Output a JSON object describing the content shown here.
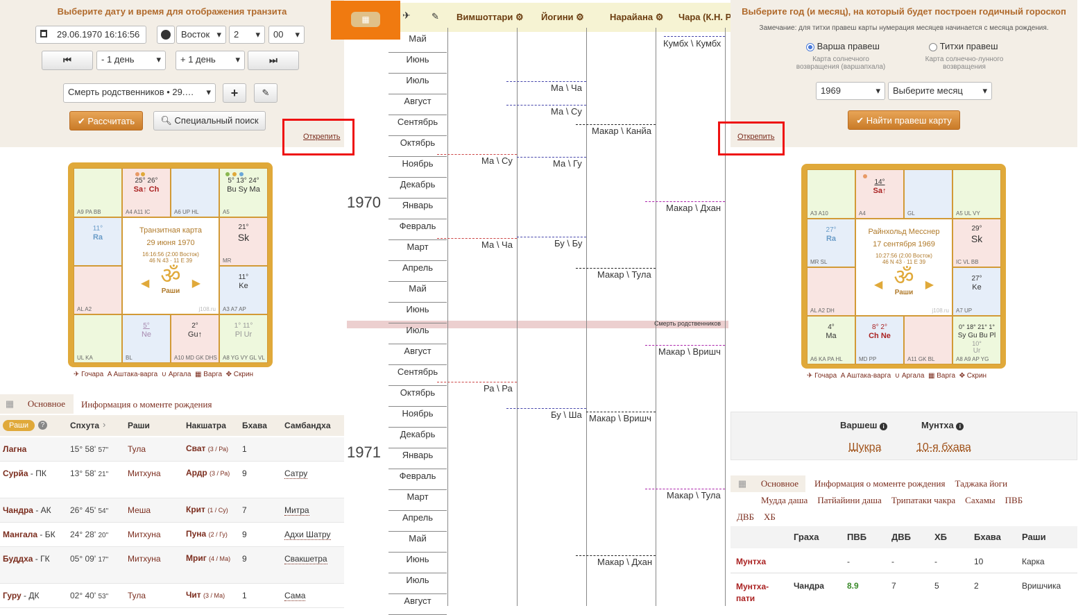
{
  "left": {
    "title": "Выберите дату и время для отображения транзита",
    "datetime": "29.06.1970 16:16:56",
    "direction": "Восток",
    "tz_hours": "2",
    "tz_minutes": "00",
    "minus_day": "- 1 день",
    "plus_day": "+ 1 день",
    "event": "Смерть родственников • 29.…",
    "calc": "Рассчитать",
    "special": "Специальный поиск",
    "unpin": "Открепить"
  },
  "right": {
    "title": "Выберите год (и месяц), на который будет построен годичный гороскоп",
    "note": "Замечание: для титхи правеш карты нумерация месяцев начинается с месяца рождения.",
    "opt1": "Варша правеш",
    "opt1_sub": "Карта солнечного возвращения (варшапхала)",
    "opt2": "Титхи правеш",
    "opt2_sub": "Карта солнечно-лунного возвращения",
    "year": "1969",
    "month": "Выберите месяц",
    "find": "Найти правеш карту",
    "unpin": "Открепить"
  },
  "chart1": {
    "center_title": "Транзитная карта",
    "center_date": "29 июня 1970",
    "center_time": "16:16:56 (2:00 Восток)",
    "center_coords": "46 N 43 · 11 E 39",
    "rashi": "Раши",
    "site": "j108.ru",
    "c1_deg": "25°  26°",
    "c1_pl": "Sa↑ Ch",
    "c1_lbl": "A4 A11 IC",
    "c0_lbl": "A9 PA BB",
    "c2_lbl": "A6 UP HL",
    "c3_deg": "5°  13° 24°",
    "c3_pl": "Bu Sy Ma",
    "c3_lbl": "A5",
    "c4_deg": "11°",
    "c4_pl": "Ra",
    "c5_deg": "21°",
    "c5_pl": "Sk",
    "c5_lbl": "MR",
    "c6_lbl": "AL A2",
    "c7_deg": "11°",
    "c7_pl": "Ke",
    "c7_lbl": "A3 A7 AP",
    "c8_lbl": "UL KA",
    "c9_deg": "5°",
    "c9_pl": "Ne",
    "c9_lbl": "BL",
    "c10_deg": "2°",
    "c10_pl": "Gu↑",
    "c10_lbl": "A10 MD GK DHS",
    "c11_deg": "1° 11°",
    "c11_pl": "Pl Ur",
    "c11_lbl": "A8 YG VY GL VL",
    "links": [
      "Гочара",
      "Аштака-варга",
      "Аргала",
      "Варга",
      "Скрин"
    ]
  },
  "chart2": {
    "center_title": "Райнхольд Месснер",
    "center_date": "17 сентября 1969",
    "center_time": "10:27:56 (2:00 Восток)",
    "center_coords": "46 N 43 · 11 E 39",
    "rashi": "Раши",
    "site": "j108.ru",
    "c0_lbl": "A3 A10",
    "c1_deg": "14°",
    "c1_pl": "Sa↑",
    "c1_lbl": "A4",
    "c2_lbl": "GL",
    "c3_lbl": "A5 UL VY",
    "c4_deg": "27°",
    "c4_pl": "Ra",
    "c4_lbl": "MR SL",
    "c5_deg": "29°",
    "c5_pl": "Sk",
    "c5_lbl": "IC VL BB",
    "c6_lbl": "AL A2 DH",
    "c7_deg": "27°",
    "c7_pl": "Ke",
    "c7_lbl": "A7 UP",
    "c8_deg": "4°",
    "c8_pl": "Ma",
    "c8_lbl": "A6 KA PA HL",
    "c9_deg": "8°  2°",
    "c9_pl": "Ch Ne",
    "c9_lbl": "MD PP",
    "c10_lbl": "A11 GK BL",
    "c11_deg": "0°  18° 21° 1°",
    "c11_pl": "Sy Gu Bu Pl",
    "c11_deg2": "10°",
    "c11_pl2": "Ur",
    "c11_lbl": "A8 A9 AP YG",
    "links": [
      "Гочара",
      "Аштака-варга",
      "Аргала",
      "Варга",
      "Скрин"
    ]
  },
  "timeline": {
    "headers": [
      "Вимшоттари",
      "Йогини",
      "Нарайана",
      "Чара (К.Н. Рао)"
    ],
    "years": [
      "1970",
      "1971"
    ],
    "months": [
      "Май",
      "Июнь",
      "Июль",
      "Август",
      "Сентябрь",
      "Октябрь",
      "Ноябрь",
      "Декабрь",
      "Январь",
      "Февраль",
      "Март",
      "Апрель",
      "Май",
      "Июнь",
      "Июль",
      "Август",
      "Сентябрь",
      "Октябрь",
      "Ноябрь",
      "Декабрь",
      "Январь",
      "Февраль",
      "Март",
      "Апрель",
      "Май",
      "Июнь",
      "Июль",
      "Август"
    ],
    "event": "Смерть родственников",
    "labels": [
      "Кумбх \\ Кумбх",
      "Ма \\ Ча",
      "Ма \\ Су",
      "Макар \\ Канйа",
      "Ма \\ Су",
      "Ма \\ Гу",
      "Макар \\ Дхан",
      "Ма \\ Ча",
      "Бу \\ Бу",
      "Макар \\ Тула",
      "Макар \\ Вришч",
      "Ра \\ Ра",
      "Бу \\ Ша",
      "Макар \\ Вришч",
      "Макар \\ Тула",
      "Макар \\ Дхан"
    ]
  },
  "left_table": {
    "tabs": [
      "Основное",
      "Информация о моменте рождения"
    ],
    "badge": "Раши",
    "cols": [
      "Спхута",
      "Раши",
      "Накшатра",
      "Бхава",
      "Самбандха"
    ],
    "rows": [
      {
        "name": "Лагна",
        "sub": "",
        "deg": "15° 58'",
        "sec": "57\"",
        "rashi": "Тула",
        "nak": "Сват",
        "nak2": "(3 / Ра)",
        "bh": "1",
        "sam": ""
      },
      {
        "name": "Сурйа",
        "sub": " - ПК",
        "deg": "13° 58'",
        "sec": "21\"",
        "rashi": "Митхуна",
        "nak": "Ардр",
        "nak2": "(3 / Ра)",
        "bh": "9",
        "sam": "Сатру"
      },
      {
        "name": "Чандра",
        "sub": " - АК",
        "deg": "26° 45'",
        "sec": "54\"",
        "rashi": "Меша",
        "nak": "Крит",
        "nak2": "(1 / Су)",
        "bh": "7",
        "sam": "Митра"
      },
      {
        "name": "Мангала",
        "sub": " - БК",
        "deg": "24° 28'",
        "sec": "20\"",
        "rashi": "Митхуна",
        "nak": "Пуна",
        "nak2": "(2 / Гу)",
        "bh": "9",
        "sam": "Адхи Шатру"
      },
      {
        "name": "Буддха",
        "sub": " - ГК",
        "deg": "05° 09'",
        "sec": "17\"",
        "rashi": "Митхуна",
        "nak": "Мриг",
        "nak2": "(4 / Ма)",
        "bh": "9",
        "sam": "Свакшетра"
      },
      {
        "name": "Гуру",
        "sub": " - ДК",
        "deg": "02° 40'",
        "sec": "53\"",
        "rashi": "Тула",
        "nak": "Чит",
        "nak2": "(3 / Ма)",
        "bh": "1",
        "sam": "Сама"
      }
    ]
  },
  "right_info": {
    "varshesh_lbl": "Варшеш",
    "muntha_lbl": "Мунтха",
    "varshesh": "Шукра",
    "muntha": "10-я бхава",
    "tabs": [
      "Основное",
      "Информация о моменте рождения",
      "Таджака йоги",
      "Мудда даша",
      "Патйайини даша",
      "Трипатаки чакра",
      "Сахамы",
      "ПВБ",
      "ДВБ",
      "ХБ"
    ],
    "cols": [
      "Граха",
      "ПВБ",
      "ДВБ",
      "ХБ",
      "Бхава",
      "Раши"
    ],
    "rows": [
      {
        "name": "Мунтха",
        "g": "",
        "pvb": "-",
        "dvb": "-",
        "hb": "-",
        "bh": "10",
        "r": "Карка"
      },
      {
        "name": "Мунтха-пати",
        "g": "Чандра",
        "pvb": "8.9",
        "dvb": "7",
        "hb": "5",
        "bh": "2",
        "r": "Вришчика"
      }
    ]
  },
  "colors": {
    "accent": "#f07a10",
    "brand": "#b06a2c",
    "red": "#e11111"
  }
}
